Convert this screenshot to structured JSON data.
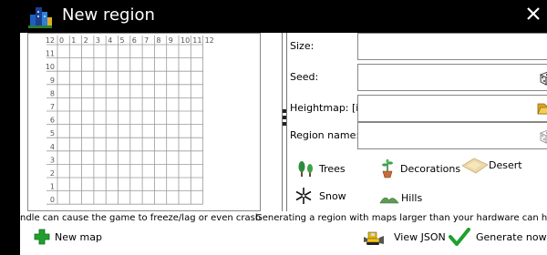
{
  "window": {
    "title": "New region",
    "icon": "city-icon",
    "close_icon": "close-icon"
  },
  "grid": {
    "x_labels": [
      "0",
      "1",
      "2",
      "3",
      "4",
      "5",
      "6",
      "7",
      "8",
      "9",
      "10",
      "11",
      "12"
    ],
    "y_labels": [
      "12",
      "11",
      "10",
      "9",
      "8",
      "7",
      "6",
      "5",
      "4",
      "3",
      "2",
      "1",
      "0"
    ]
  },
  "form": {
    "size_label": "Size:",
    "size_value": "",
    "seed_label": "Seed:",
    "seed_value": "",
    "seed_icon": "dice-icon",
    "heightmap_label": "Heightmap: [i]",
    "heightmap_value": "",
    "heightmap_icon": "folder-icon",
    "region_name_label": "Region name:",
    "region_name_value": "",
    "region_name_icon": "dice-icon"
  },
  "features": [
    {
      "label": "Trees",
      "icon": "trees-icon"
    },
    {
      "label": "Decorations",
      "icon": "decorations-icon"
    },
    {
      "label": "Desert",
      "icon": "desert-icon"
    },
    {
      "label": "Snow",
      "icon": "snow-icon"
    },
    {
      "label": "Hills",
      "icon": "hills-icon"
    }
  ],
  "warnings": {
    "left": "ndle can cause the game to freeze/lag or even crash",
    "right": "Generating a region with maps larger than your hardware can handle ca"
  },
  "actions": {
    "new_map": "New map",
    "view_json": "View JSON",
    "generate_now": "Generate now"
  },
  "colors": {
    "background": "#000000",
    "panel": "#ffffff",
    "grid_line": "#9a9a9a",
    "accent_green": "#1f9b2c"
  }
}
